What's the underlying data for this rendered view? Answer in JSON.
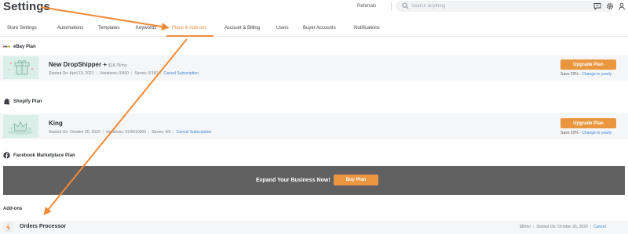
{
  "header": {
    "title": "Settings",
    "referrals": "Referrals",
    "search_placeholder": "Search anything"
  },
  "tabs": [
    {
      "label": "Store Settings"
    },
    {
      "label": "Automations"
    },
    {
      "label": "Templates"
    },
    {
      "label": "Keywords"
    },
    {
      "label": "Plans & Add-ons"
    },
    {
      "label": "Account & Billing"
    },
    {
      "label": "Users"
    },
    {
      "label": "Buyer Accounts"
    },
    {
      "label": "Notifications"
    }
  ],
  "active_tab": "Plans & Add-ons",
  "ebay": {
    "heading": "eBay Plan",
    "plan_name": "New DropShipper +",
    "price": "$18.79/mo",
    "started": "Started On: April 19, 2021",
    "variations": "Variations: 0/400",
    "stores": "Stores: 0/150",
    "cancel": "Cancel Subscription",
    "upgrade": "Upgrade Plan",
    "save_text": "Save 20% - ",
    "yearly": "Change to yearly"
  },
  "shopify": {
    "heading": "Shopify Plan",
    "plan_name": "King",
    "started": "Started On: October 26, 2020",
    "variations": "Variations: 5196/10000",
    "stores": "Stores: 4/5",
    "cancel": "Cancel Subscription",
    "upgrade": "Upgrade Plan",
    "save_text": "Save 20% - ",
    "yearly": "Change to yearly"
  },
  "facebook": {
    "heading": "Facebook Marketplace Plan",
    "banner_text": "Expand Your Business Now!",
    "buy": "Buy Plan"
  },
  "addons": {
    "heading": "Add-ons",
    "items": [
      {
        "name": "Orders Processor",
        "price": "$8/mo",
        "started": "Started On: October 26, 2020",
        "cancel": "Cancel"
      }
    ]
  },
  "colors": {
    "accent": "#ec8e3d",
    "button": "#e9963f",
    "link": "#3b84d9",
    "banner": "#616161",
    "annotation_arrow": "#f08a38"
  },
  "icons": [
    "search-icon",
    "chat-icon",
    "gear-icon",
    "user-icon",
    "ebay-logo-icon",
    "shopify-icon",
    "facebook-icon",
    "gift-box-icon",
    "crown-icon",
    "lightning-icon"
  ]
}
